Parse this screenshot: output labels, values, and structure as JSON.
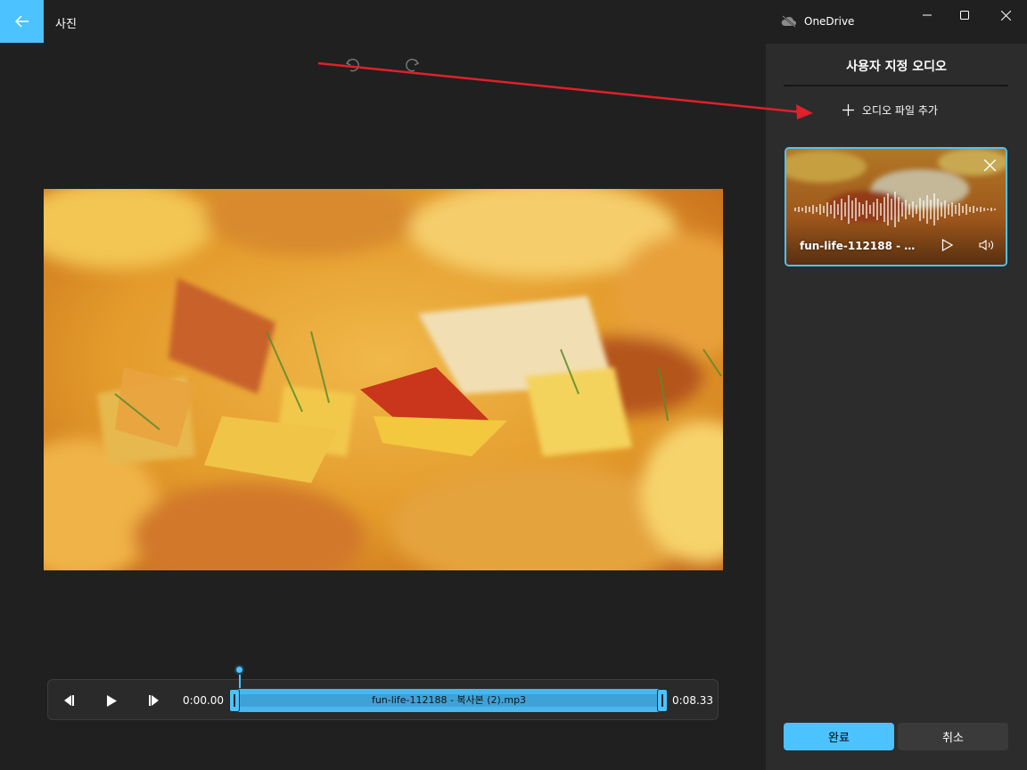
{
  "window": {
    "app_title": "사진",
    "cloud_label": "OneDrive"
  },
  "toolbar": {
    "undo_icon": "undo-icon",
    "redo_icon": "redo-icon"
  },
  "timeline": {
    "start_time": "0:00.00",
    "end_time": "0:08.33",
    "track_label": "fun-life-112188 - 복사본 (2).mp3"
  },
  "panel": {
    "title": "사용자 지정 오디오",
    "add_audio_label": "오디오 파일 추가",
    "audio_card": {
      "name": "fun-life-112188 - 복..."
    },
    "done_label": "완료",
    "cancel_label": "취소"
  },
  "colors": {
    "accent": "#4cc2ff",
    "background": "#202020",
    "panel": "#2c2c2c",
    "annotation_arrow": "#e0202a"
  }
}
